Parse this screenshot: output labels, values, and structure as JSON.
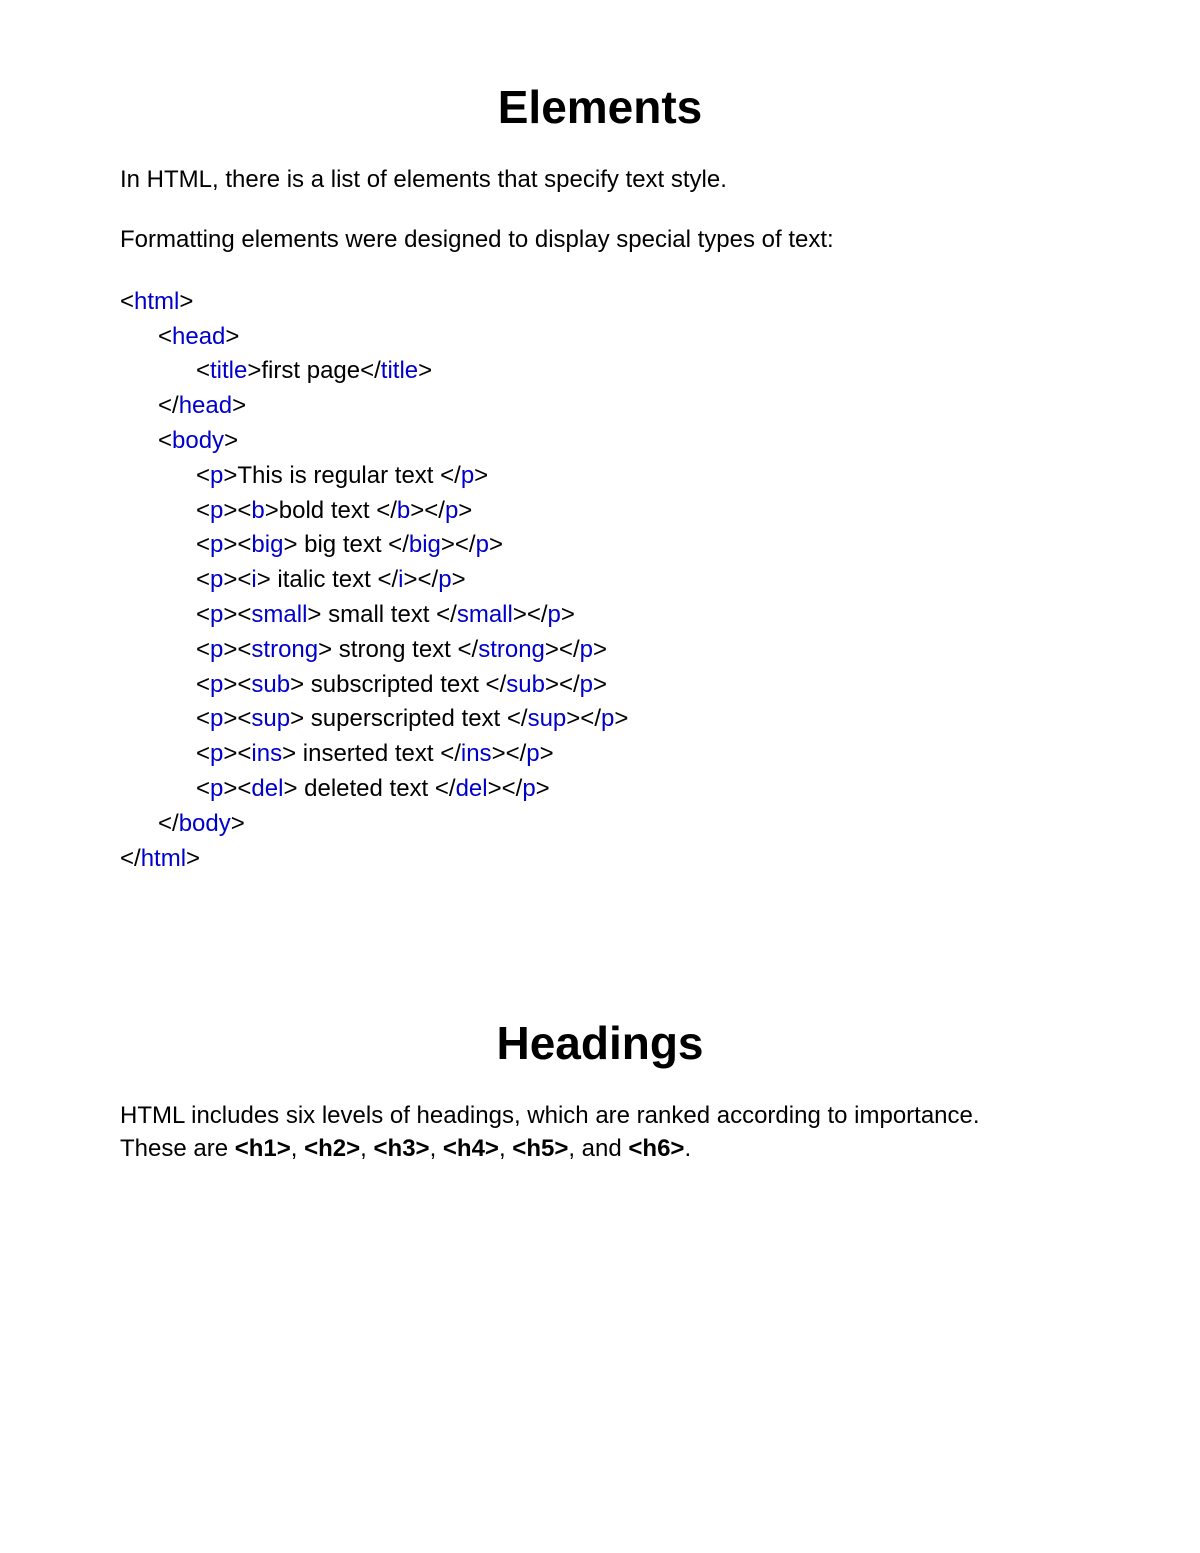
{
  "section1": {
    "title": "Elements",
    "p1": "In HTML, there is a list of elements that specify text style.",
    "p2": "Formatting elements were designed to display special types of text:"
  },
  "code": {
    "l1": {
      "open": "html"
    },
    "l2": {
      "open": "head"
    },
    "l3": {
      "open": "title",
      "text": "first page",
      "close": "title"
    },
    "l4": {
      "close": "head"
    },
    "l5": {
      "open": "body"
    },
    "l6": {
      "open": "p",
      "text": "This is regular text ",
      "close": "p"
    },
    "l7": {
      "o1": "p",
      "o2": "b",
      "text": "bold text ",
      "c1": "b",
      "c2": "p"
    },
    "l8": {
      "o1": "p",
      "o2": "big",
      "text": " big text ",
      "c1": "big",
      "c2": "p"
    },
    "l9": {
      "o1": "p",
      "o2": "i",
      "text": " italic text ",
      "c1": "i",
      "c2": "p"
    },
    "l10": {
      "o1": "p",
      "o2": "small",
      "text": " small text ",
      "c1": "small",
      "c2": "p"
    },
    "l11": {
      "o1": "p",
      "o2": "strong",
      "text": " strong text ",
      "c1": "strong",
      "c2": "p"
    },
    "l12": {
      "o1": "p",
      "o2": "sub",
      "text": " subscripted text ",
      "c1": "sub",
      "c2": "p"
    },
    "l13": {
      "o1": "p",
      "o2": "sup",
      "text": " superscripted text ",
      "c1": "sup",
      "c2": "p"
    },
    "l14": {
      "o1": "p",
      "o2": "ins",
      "text": " inserted text ",
      "c1": "ins",
      "c2": "p"
    },
    "l15": {
      "o1": "p",
      "o2": "del",
      "text": " deleted text ",
      "c1": "del",
      "c2": "p"
    },
    "l16": {
      "close": "body"
    },
    "l17": {
      "close": "html"
    }
  },
  "section2": {
    "title": "Headings",
    "p1a": "HTML includes six levels of headings, which are ranked according to importance.",
    "p1b": "These are ",
    "h1": "<h1>",
    "c1": ", ",
    "h2": "<h2>",
    "c2": ", ",
    "h3": "<h3>",
    "c3": ", ",
    "h4": "<h4>",
    "c4": ", ",
    "h5": "<h5>",
    "c5": ", and ",
    "h6": "<h6>",
    "end": "."
  },
  "brackets": {
    "lt": "<",
    "gt": ">",
    "ltc": "</"
  }
}
